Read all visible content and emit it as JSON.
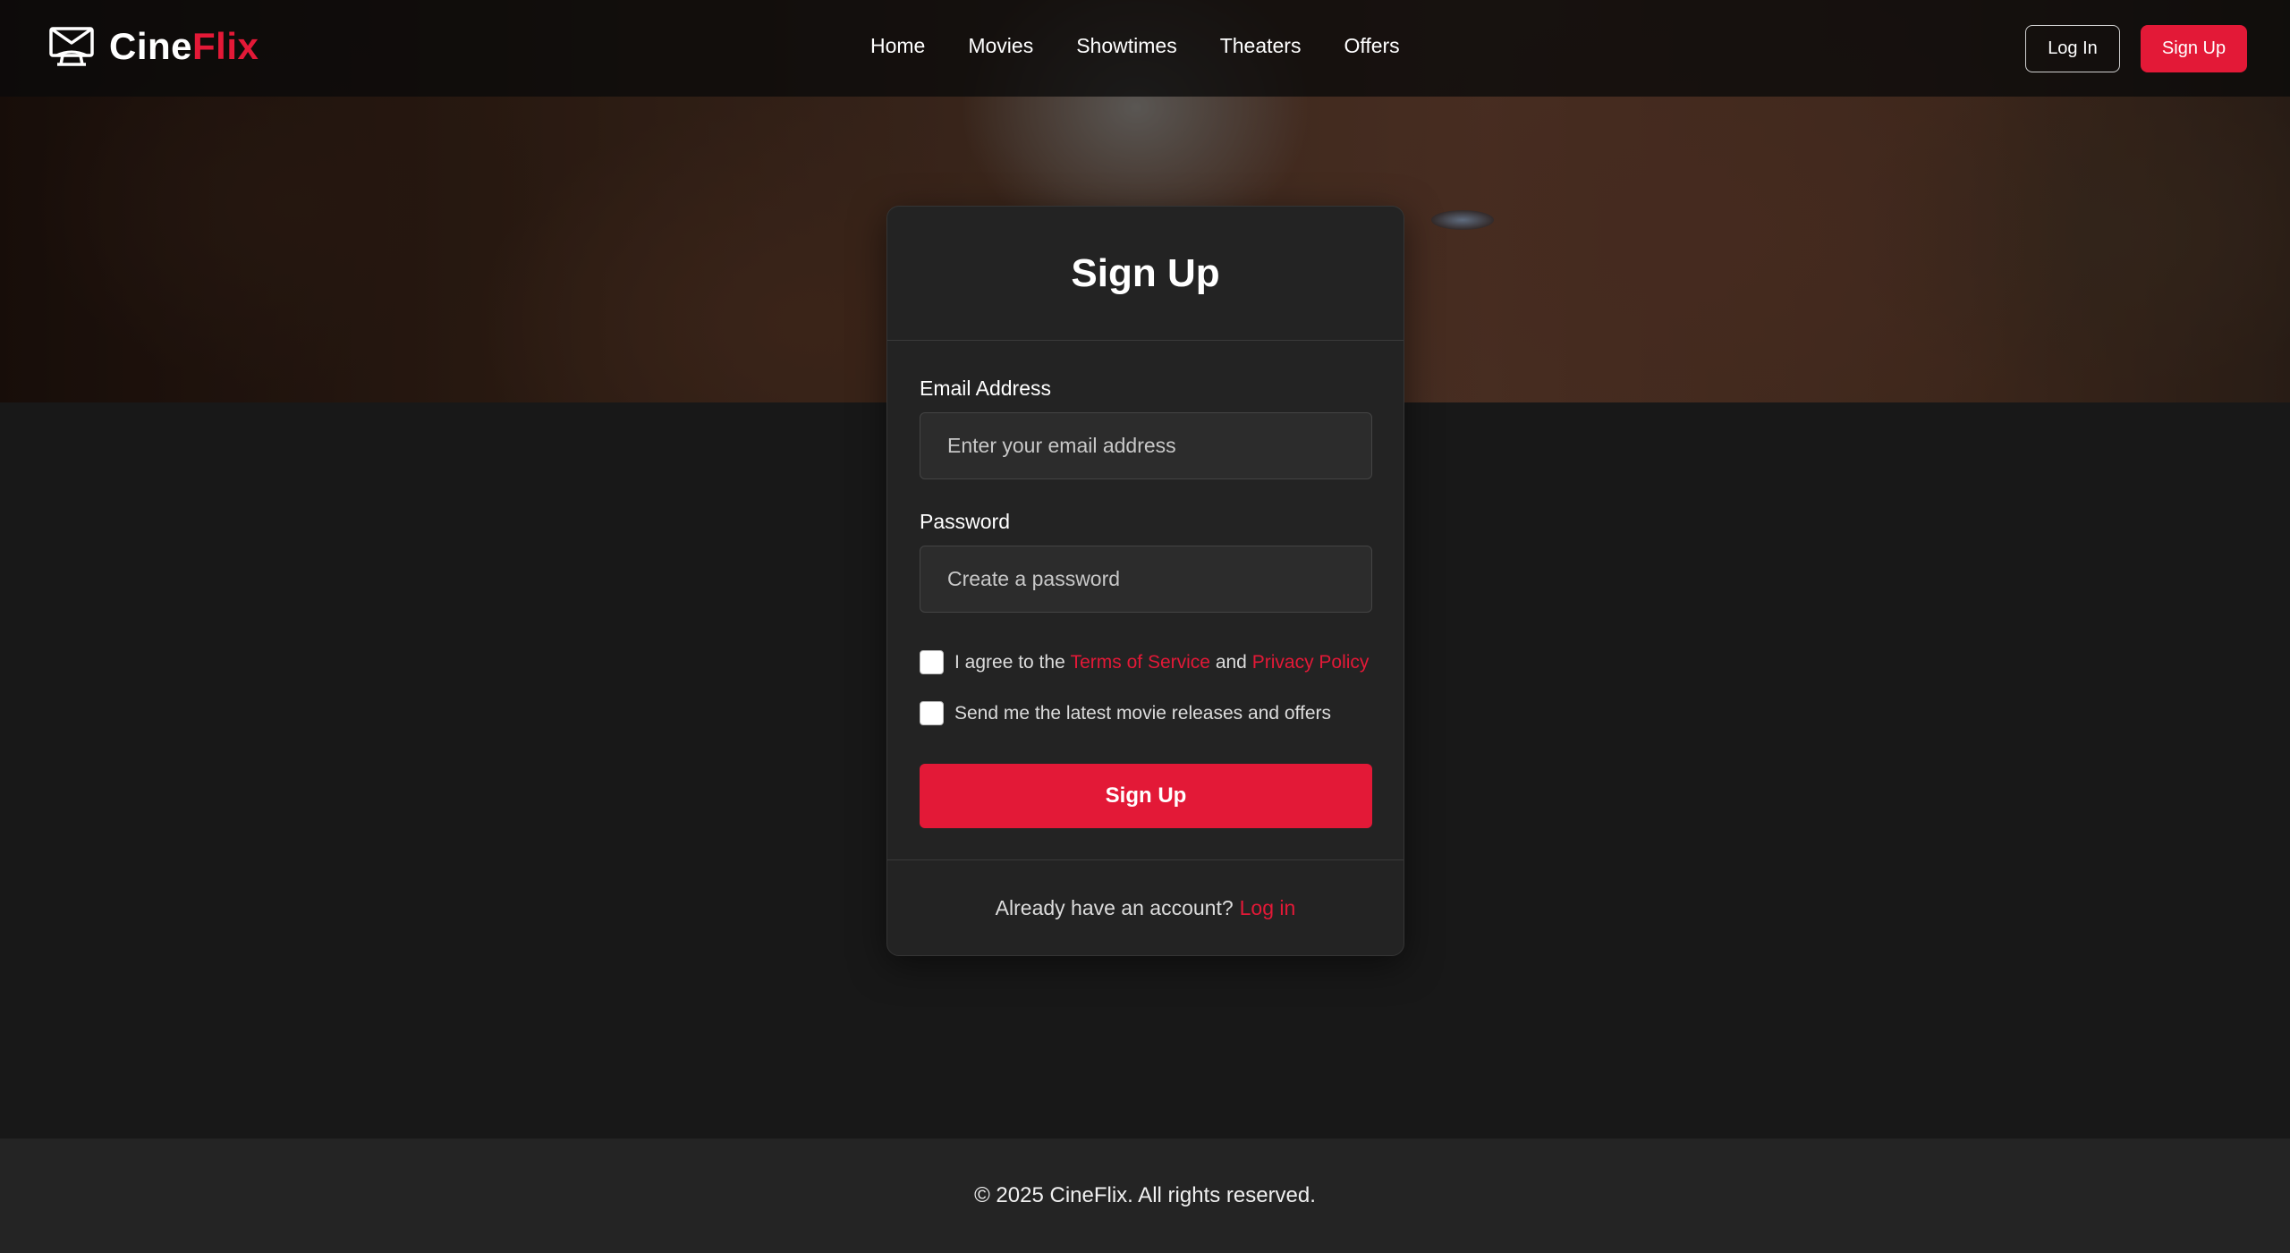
{
  "brand": {
    "name_part1": "Cine",
    "name_part2": "Flix",
    "accent_color": "#e31937",
    "icon": "film-screen-icon"
  },
  "nav": {
    "items": [
      {
        "label": "Home"
      },
      {
        "label": "Movies"
      },
      {
        "label": "Showtimes"
      },
      {
        "label": "Theaters"
      },
      {
        "label": "Offers"
      }
    ]
  },
  "header_actions": {
    "login_label": "Log In",
    "signup_label": "Sign Up"
  },
  "form": {
    "title": "Sign Up",
    "email": {
      "label": "Email Address",
      "placeholder": "Enter your email address",
      "value": ""
    },
    "password": {
      "label": "Password",
      "placeholder": "Create a password",
      "value": ""
    },
    "terms": {
      "prefix": "I agree to the",
      "terms_link": "Terms of Service",
      "conjunction": "and",
      "privacy_link": "Privacy Policy",
      "checked": false
    },
    "newsletter": {
      "label": "Send me the latest movie releases and offers",
      "checked": false
    },
    "submit_label": "Sign Up",
    "footer_text": "Already have an account?",
    "footer_link": "Log in"
  },
  "footer": {
    "copyright": "© 2025 CineFlix. All rights reserved."
  }
}
